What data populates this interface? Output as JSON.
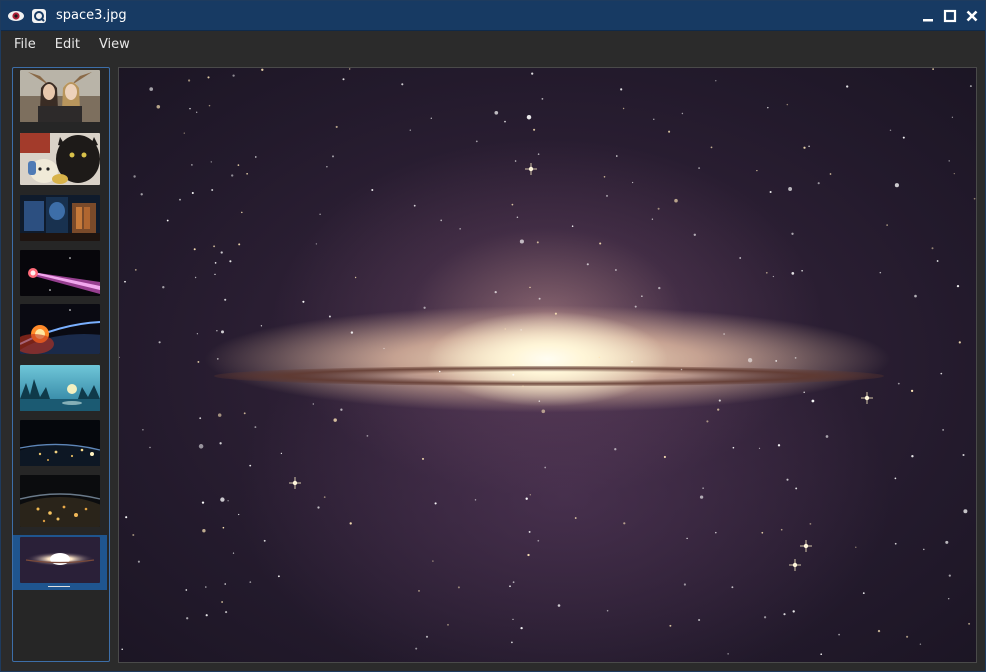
{
  "window": {
    "title": "space3.jpg",
    "app_icon": "eye-icon",
    "second_icon": "lens-icon",
    "controls": [
      "minimize-icon",
      "maximize-icon",
      "close-icon"
    ],
    "titlebar_color": "#173a63"
  },
  "menu": {
    "file": "File",
    "edit": "Edit",
    "view": "View"
  },
  "thumbnails": {
    "selected_index": 8,
    "accent": "#1f558f",
    "items": [
      {
        "name": "portrait-with-wings"
      },
      {
        "name": "cats-with-toys"
      },
      {
        "name": "blue-interior"
      },
      {
        "name": "pink-comet"
      },
      {
        "name": "planet-sunrise"
      },
      {
        "name": "lake-forest"
      },
      {
        "name": "earth-night-lights"
      },
      {
        "name": "earth-cities-night"
      },
      {
        "name": "galaxy"
      }
    ]
  },
  "viewer": {
    "image": "galaxy"
  }
}
